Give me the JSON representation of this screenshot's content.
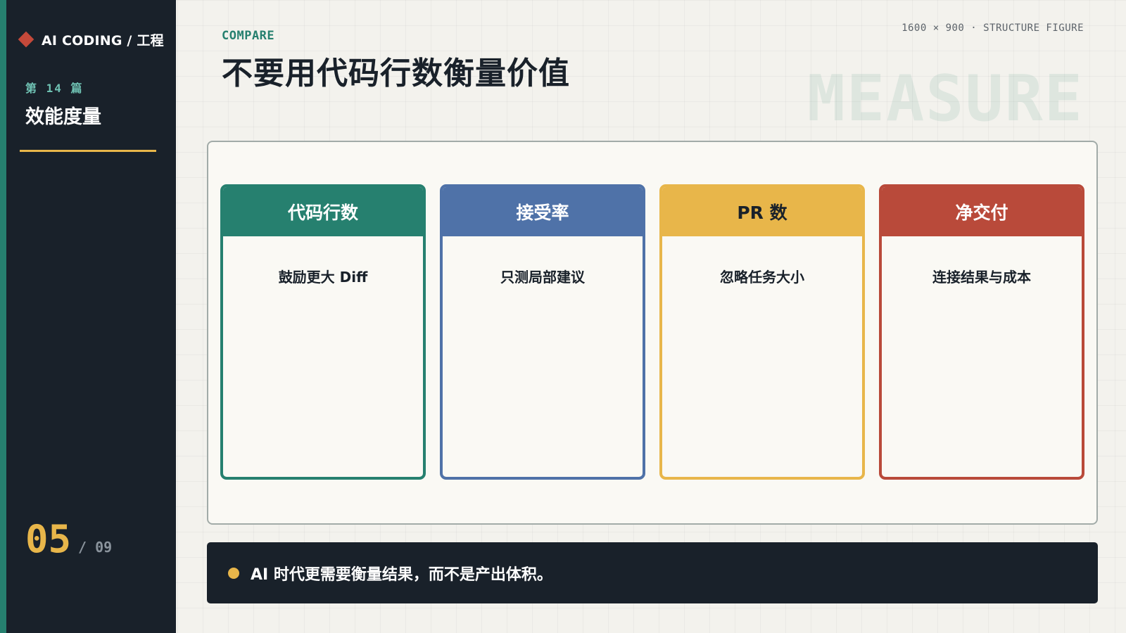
{
  "sidebar": {
    "brand_icon": "diamond-icon",
    "brand_text": "AI CODING / 工程",
    "part_label": "第 14 篇",
    "part_title": "效能度量",
    "page_current": "05",
    "page_total": "/ 09"
  },
  "header": {
    "eyebrow": "COMPARE",
    "title": "不要用代码行数衡量价值",
    "meta": "1600 × 900 · STRUCTURE FIGURE",
    "watermark": "MEASURE"
  },
  "cards": [
    {
      "title": "代码行数",
      "body": "鼓励更大 Diff",
      "color": "#26806f"
    },
    {
      "title": "接受率",
      "body": "只测局部建议",
      "color": "#4f72a8"
    },
    {
      "title": "PR 数",
      "body": "忽略任务大小",
      "color": "#e8b64a"
    },
    {
      "title": "净交付",
      "body": "连接结果与成本",
      "color": "#b94a3a"
    }
  ],
  "callout": {
    "text": "AI 时代更需要衡量结果，而不是产出体积。"
  },
  "colors": {
    "sidebar_bg": "#19212a",
    "accent_teal": "#26806f",
    "accent_gold": "#e8b64a",
    "accent_red": "#c4493a"
  }
}
